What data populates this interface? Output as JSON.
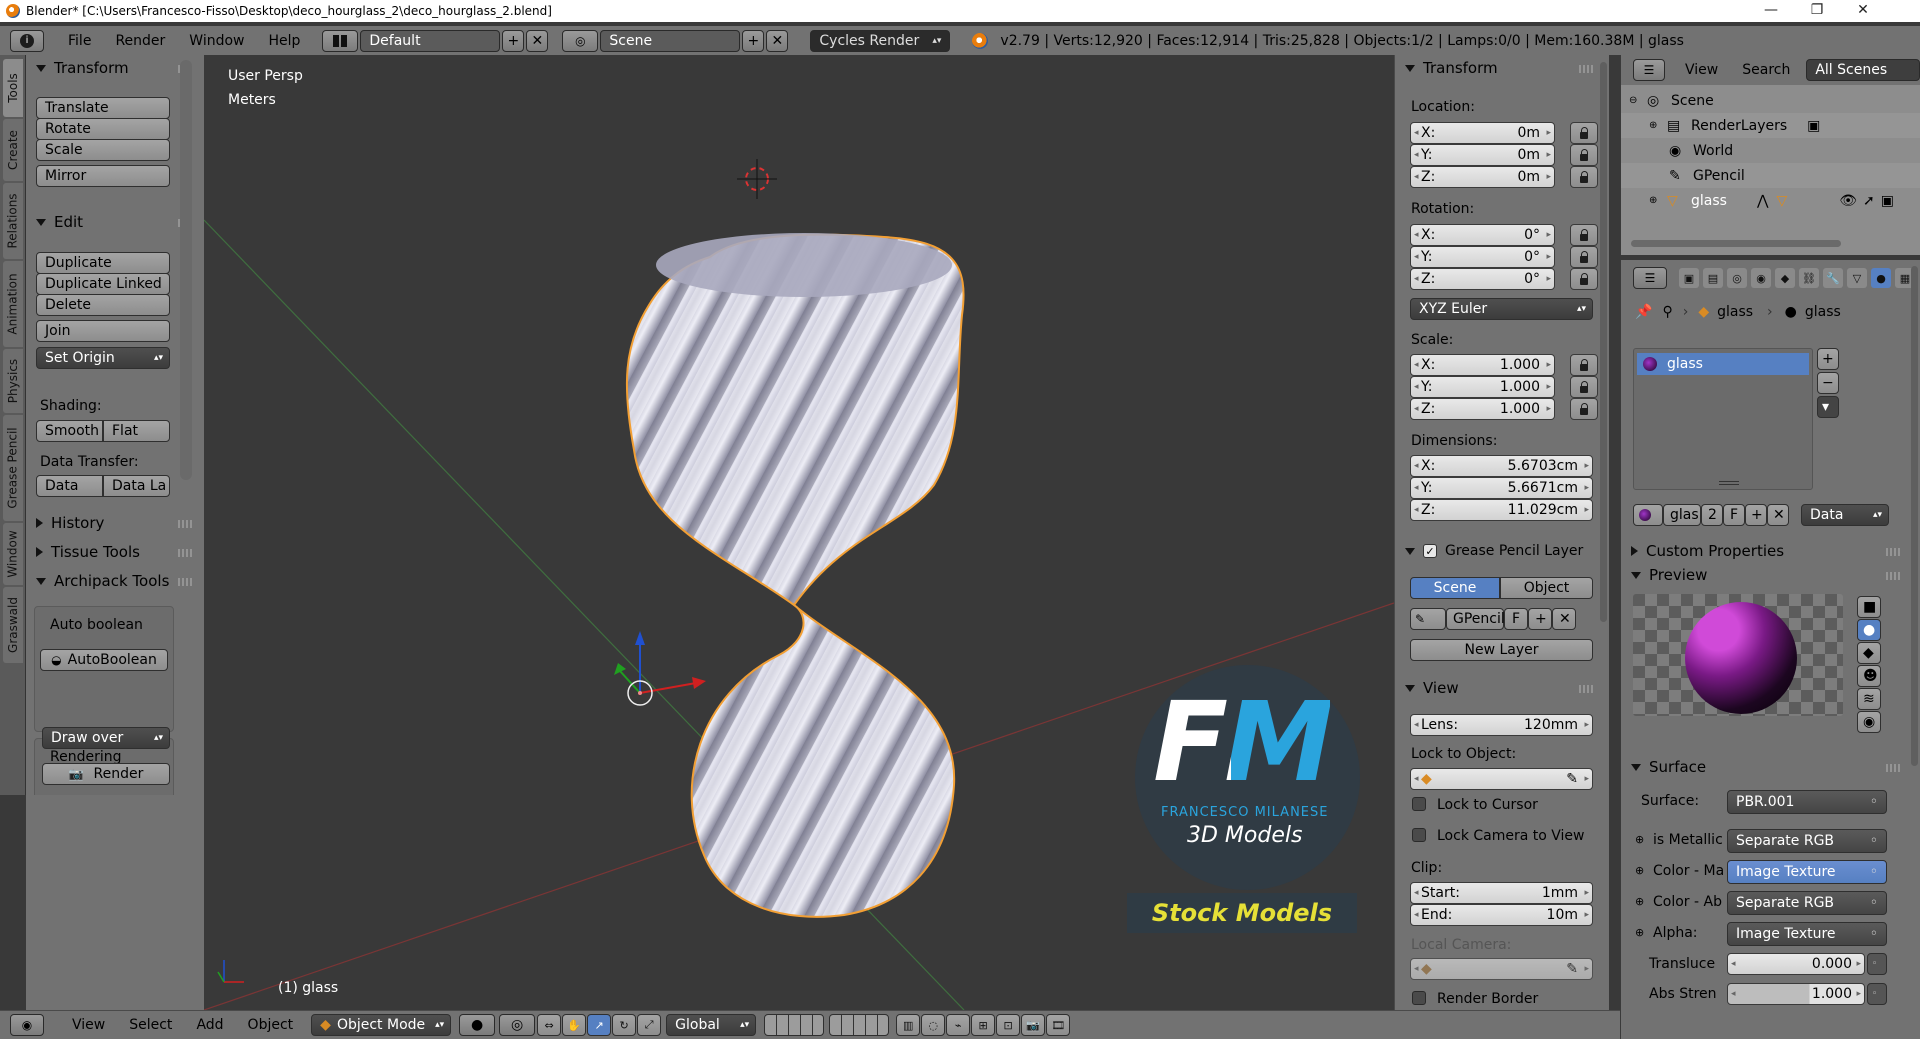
{
  "window": {
    "title": "Blender* [C:\\Users\\Francesco-Fisso\\Desktop\\deco_hourglass_2\\deco_hourglass_2.blend]",
    "minimize": "—",
    "maximize": "❐",
    "close": "✕"
  },
  "info_header": {
    "menus": [
      "File",
      "Render",
      "Window",
      "Help"
    ],
    "screen_layout": "Default",
    "scene": "Scene",
    "render_engine": "Cycles Render",
    "stats": "v2.79 | Verts:12,920 | Faces:12,914 | Tris:25,828 | Objects:1/2 | Lamps:0/0 | Mem:160.38M | glass"
  },
  "left_tabs": [
    "Tools",
    "Create",
    "Relations",
    "Animation",
    "Physics",
    "Grease Pencil",
    "Window",
    "Graswald"
  ],
  "tool_shelf": {
    "transform": {
      "title": "Transform",
      "buttons": [
        "Translate",
        "Rotate",
        "Scale",
        "Mirror"
      ]
    },
    "edit": {
      "title": "Edit",
      "buttons": [
        "Duplicate",
        "Duplicate Linked",
        "Delete",
        "Join"
      ],
      "set_origin": "Set Origin",
      "shading_label": "Shading:",
      "smooth": "Smooth",
      "flat": "Flat",
      "data_transfer_label": "Data Transfer:",
      "data": "Data",
      "data_la": "Data La"
    },
    "history": "History",
    "tissue_tools": "Tissue Tools",
    "archipack": {
      "title": "Archipack Tools",
      "auto_boolean_label": "Auto boolean",
      "auto_boolean_btn": "AutoBoolean",
      "rendering_label": "Rendering",
      "draw_over": "Draw over",
      "render": "Render"
    }
  },
  "viewport": {
    "view_name": "User Persp",
    "units": "Meters",
    "object_label": "(1) glass"
  },
  "watermark": {
    "logo": "FM",
    "name": "FRANCESCO MILANESE",
    "subtitle": "3D Models",
    "banner": "Stock Models"
  },
  "n_panel": {
    "transform_title": "Transform",
    "location_label": "Location:",
    "location": [
      {
        "axis": "X:",
        "value": "0m"
      },
      {
        "axis": "Y:",
        "value": "0m"
      },
      {
        "axis": "Z:",
        "value": "0m"
      }
    ],
    "rotation_label": "Rotation:",
    "rotation": [
      {
        "axis": "X:",
        "value": "0°"
      },
      {
        "axis": "Y:",
        "value": "0°"
      },
      {
        "axis": "Z:",
        "value": "0°"
      }
    ],
    "rotation_mode": "XYZ Euler",
    "scale_label": "Scale:",
    "scale": [
      {
        "axis": "X:",
        "value": "1.000"
      },
      {
        "axis": "Y:",
        "value": "1.000"
      },
      {
        "axis": "Z:",
        "value": "1.000"
      }
    ],
    "dimensions_label": "Dimensions:",
    "dimensions": [
      {
        "axis": "X:",
        "value": "5.6703cm"
      },
      {
        "axis": "Y:",
        "value": "5.6671cm"
      },
      {
        "axis": "Z:",
        "value": "11.029cm"
      }
    ],
    "grease_pencil_title": "Grease Pencil Layer",
    "gp_scene": "Scene",
    "gp_object": "Object",
    "gp_name": "GPencil",
    "gp_f": "F",
    "new_layer": "New Layer",
    "view_title": "View",
    "lens_label": "Lens:",
    "lens_value": "120mm",
    "lock_to_object_label": "Lock to Object:",
    "lock_to_cursor": "Lock to Cursor",
    "lock_camera_to_view": "Lock Camera to View",
    "clip_label": "Clip:",
    "clip_start_label": "Start:",
    "clip_start": "1mm",
    "clip_end_label": "End:",
    "clip_end": "10m",
    "local_camera_label": "Local Camera:",
    "render_border": "Render Border"
  },
  "outliner": {
    "menus": [
      "View",
      "Search"
    ],
    "filter": "All Scenes",
    "rows": [
      "Scene",
      "RenderLayers",
      "World",
      "GPencil",
      "glass"
    ]
  },
  "properties": {
    "breadcrumb_object": "glass",
    "breadcrumb_material": "glass",
    "slot_name": "glass",
    "material_name": "glas",
    "users": "2",
    "f_label": "F",
    "link": "Data",
    "custom_properties": "Custom Properties",
    "preview": "Preview",
    "surface_title": "Surface",
    "surface_label": "Surface:",
    "surface_value": "PBR.001",
    "inputs": [
      {
        "label": "is Metallic",
        "value": "Separate RGB"
      },
      {
        "label": "Color - Ma",
        "value": "Image Texture"
      },
      {
        "label": "Color - Ab",
        "value": "Separate RGB"
      },
      {
        "label": "Alpha:",
        "value": "Image Texture"
      }
    ],
    "translucent_label": "Transluce",
    "translucent_value": "0.000",
    "abs_strength_label": "Abs Stren",
    "abs_strength_value": "1.000"
  },
  "bottom_bar": {
    "menus": [
      "View",
      "Select",
      "Add",
      "Object"
    ],
    "mode": "Object Mode",
    "orientation": "Global"
  },
  "colors": {
    "panel": "#727272",
    "viewport": "#393939",
    "selection_blue": "#5680c2",
    "object_outline": "#f29f34",
    "watermark_blue": "#2aa4dd",
    "watermark_yellow": "#e6e037"
  }
}
